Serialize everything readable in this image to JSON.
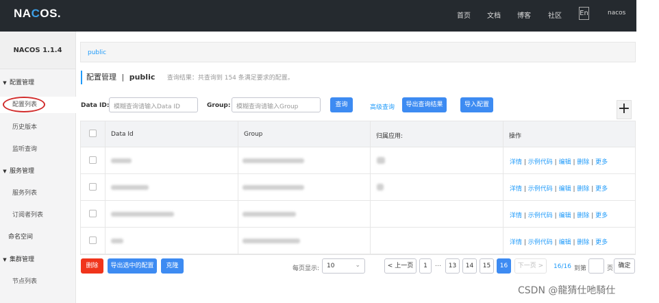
{
  "header": {
    "logo_prefix": "NA",
    "logo_o": "C",
    "logo_suffix": "OS.",
    "nav": [
      "首页",
      "文档",
      "博客",
      "社区"
    ],
    "lang": "En",
    "user": "nacos"
  },
  "sidebar": {
    "version": "NACOS 1.1.4",
    "groups": [
      {
        "label": "配置管理",
        "items": [
          "配置列表",
          "历史版本",
          "监听查询"
        ]
      },
      {
        "label": "服务管理",
        "items": [
          "服务列表",
          "订阅者列表"
        ]
      },
      {
        "label": "命名空间",
        "items": []
      },
      {
        "label": "集群管理",
        "items": [
          "节点列表"
        ]
      }
    ],
    "active_item": "配置列表"
  },
  "namespace_tab": "public",
  "title": {
    "main": "配置管理",
    "sep": "|",
    "namespace": "public",
    "hint": "查询结果：共查询到 154 条满足要求的配置。"
  },
  "filters": {
    "data_id_label": "Data ID:",
    "data_id_placeholder": "模糊查询请输入Data ID",
    "group_label": "Group:",
    "group_placeholder": "模糊查询请输入Group",
    "query_button": "查询",
    "advanced_link": "高级查询",
    "export_button": "导出查询结果",
    "import_button": "导入配置",
    "add_icon": "+"
  },
  "table": {
    "columns": [
      "Data Id",
      "Group",
      "归属应用:",
      "操作"
    ],
    "rows": [
      {
        "data_id_w": 30,
        "group_w": 90,
        "app_w": 12
      },
      {
        "data_id_w": 55,
        "group_w": 90,
        "app_w": 10
      },
      {
        "data_id_w": 92,
        "group_w": 78,
        "app_w": 0
      },
      {
        "data_id_w": 18,
        "group_w": 84,
        "app_w": 0
      }
    ],
    "row_actions": [
      "洋情",
      "示例代码",
      "编辑",
      "删除",
      "更多"
    ]
  },
  "footer": {
    "delete_button": "删除",
    "export_selected_button": "导出选中的配置",
    "clone_button": "克隆",
    "page_size_label": "每页显示:",
    "page_size": "10",
    "prev": "< 上一页",
    "pages": [
      "1",
      "…",
      "13",
      "14",
      "15",
      "16"
    ],
    "current_page": "16",
    "next": "下一页 >",
    "page_status": "16/16",
    "goto_label": "到第",
    "page_unit": "页",
    "confirm_button": "确定"
  },
  "watermark": "CSDN @龍猜仕吔騎仕"
}
